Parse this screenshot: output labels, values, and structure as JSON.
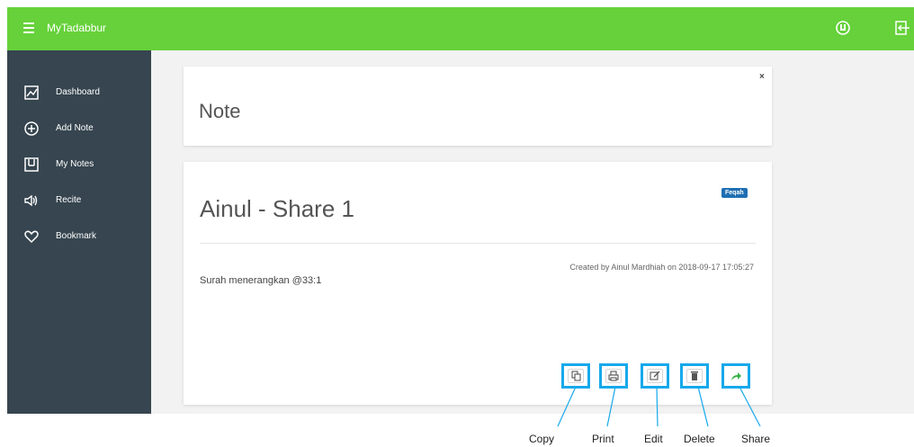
{
  "topbar": {
    "brand": "MyTadabbur",
    "menu_icon": "hamburger-icon",
    "user_icon": "user-icon",
    "logout_icon": "logout-icon",
    "color": "#66d13a"
  },
  "sidebar": {
    "color": "#36454f",
    "items": [
      {
        "label": "Dashboard",
        "icon": "chart-icon"
      },
      {
        "label": "Add Note",
        "icon": "plus-circle-icon"
      },
      {
        "label": "My Notes",
        "icon": "notebook-icon"
      },
      {
        "label": "Recite",
        "icon": "speaker-icon"
      },
      {
        "label": "Bookmark",
        "icon": "heart-icon"
      }
    ]
  },
  "note_card": {
    "title": "Note",
    "close": "×"
  },
  "share_card": {
    "title": "Ainul - Share 1",
    "badge": "Feqah",
    "meta": "Created by Ainul Mardhiah on 2018-09-17 17:05:27",
    "body": "Surah menerangkan @33:1"
  },
  "actions": [
    {
      "name": "copy",
      "icon": "copy-icon"
    },
    {
      "name": "print",
      "icon": "print-icon"
    },
    {
      "name": "edit",
      "icon": "edit-icon"
    },
    {
      "name": "delete",
      "icon": "trash-icon"
    },
    {
      "name": "share",
      "icon": "share-icon"
    }
  ],
  "callouts": {
    "copy": "Copy",
    "print": "Print",
    "edit": "Edit",
    "delete": "Delete",
    "share": "Share"
  },
  "highlight_color": "#16a9ec"
}
